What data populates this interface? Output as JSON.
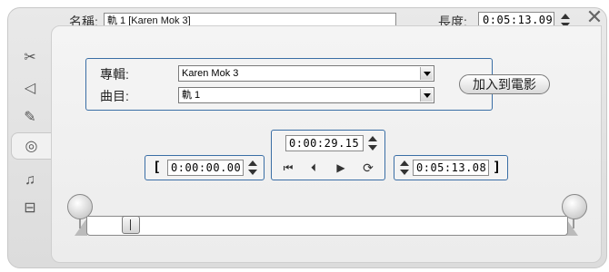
{
  "header": {
    "name_label": "名稱:",
    "name_value": "軌 1 [Karen Mok 3]",
    "duration_label": "長度:",
    "duration_value": "0:05:13.09",
    "close_icon": "close-icon"
  },
  "sidetabs": [
    {
      "icon": "video-edit-icon",
      "glyph": "✂"
    },
    {
      "icon": "audio-icon",
      "glyph": "◁"
    },
    {
      "icon": "paint-icon",
      "glyph": "✎"
    },
    {
      "icon": "cd-icon",
      "glyph": "◎"
    },
    {
      "icon": "music-note-icon",
      "glyph": "♫"
    },
    {
      "icon": "volume-icon",
      "glyph": "⊟"
    }
  ],
  "album": {
    "album_label": "專輯:",
    "album_value": "Karen Mok 3",
    "track_label": "曲目:",
    "track_value": "軌 1",
    "add_button": "加入到電影"
  },
  "times": {
    "current": "0:00:29.15",
    "in_point": "0:00:00.00",
    "out_point": "0:05:13.08",
    "open_bracket": "[",
    "close_bracket": "]"
  },
  "transport": {
    "rewind": "⏮",
    "prev": "⏴",
    "play": "▶",
    "loop": "⟳"
  },
  "timeline": {
    "playhead_fraction": 0.093
  }
}
